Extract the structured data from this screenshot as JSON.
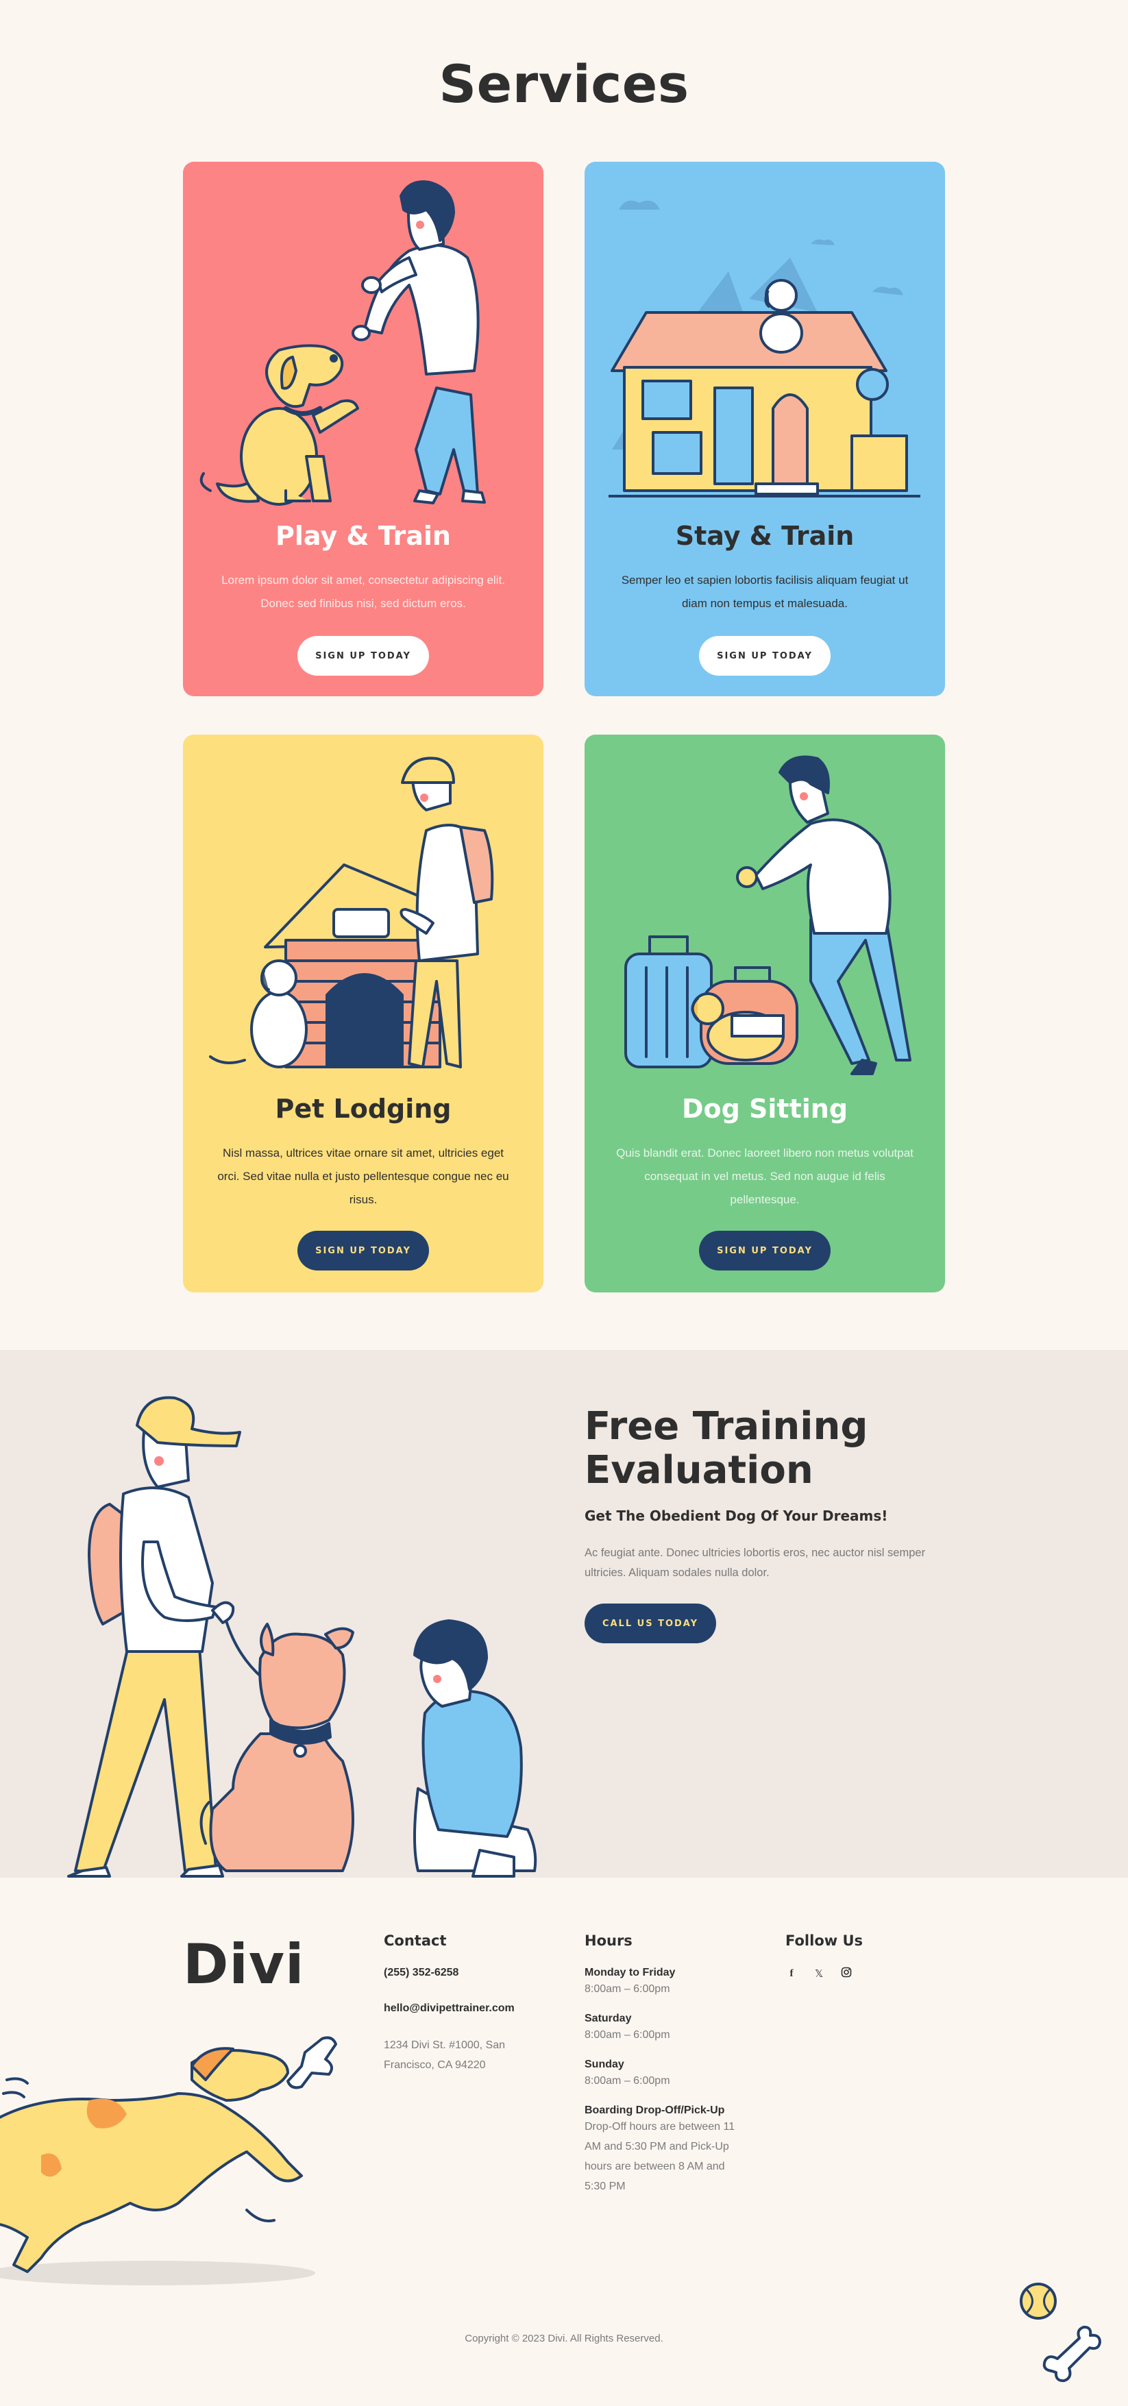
{
  "services": {
    "title": "Services",
    "cards": [
      {
        "title": "Play & Train",
        "description": "Lorem ipsum dolor sit amet, consectetur adipiscing elit. Donec sed finibus nisi, sed dictum eros.",
        "button": "SIGN UP TODAY",
        "bg_color": "#fd8484"
      },
      {
        "title": "Stay & Train",
        "description": "Semper leo et sapien lobortis facilisis aliquam feugiat ut diam non tempus et malesuada.",
        "button": "SIGN UP TODAY",
        "bg_color": "#7cc7f1"
      },
      {
        "title": "Pet Lodging",
        "description": "Nisl massa, ultrices vitae ornare sit amet, ultricies eget orci. Sed vitae nulla et justo pellentesque congue nec eu risus.",
        "button": "SIGN UP TODAY",
        "bg_color": "#fddf7d"
      },
      {
        "title": "Dog Sitting",
        "description": "Quis blandit erat. Donec laoreet libero non metus volutpat consequat in vel metus. Sed non augue id felis pellentesque.",
        "button": "SIGN UP TODAY",
        "bg_color": "#76cb88"
      }
    ]
  },
  "evaluation": {
    "title": "Free Training Evaluation",
    "subtitle": "Get The Obedient Dog Of Your Dreams!",
    "description": "Ac feugiat ante. Donec ultricies lobortis eros, nec auctor nisl semper ultricies. Aliquam sodales nulla dolor.",
    "button": "CALL US TODAY"
  },
  "footer": {
    "logo": "Divi",
    "contact": {
      "heading": "Contact",
      "phone": "(255) 352-6258",
      "email": "hello@divipettrainer.com",
      "address": "1234 Divi St. #1000, San Francisco, CA 94220"
    },
    "hours": {
      "heading": "Hours",
      "entries": [
        {
          "label": "Monday to Friday",
          "value": "8:00am – 6:00pm"
        },
        {
          "label": "Saturday",
          "value": "8:00am – 6:00pm"
        },
        {
          "label": "Sunday",
          "value": "8:00am – 6:00pm"
        },
        {
          "label": "Boarding Drop-Off/Pick-Up",
          "value": "Drop-Off hours are between 11 AM and 5:30 PM and Pick-Up hours are between 8 AM and 5:30 PM"
        }
      ]
    },
    "follow": {
      "heading": "Follow Us",
      "icons": [
        "facebook-icon",
        "x-twitter-icon",
        "instagram-icon"
      ]
    },
    "copyright": "Copyright © 2023 Divi. All Rights Reserved."
  },
  "colors": {
    "page_bg": "#fcf6f1",
    "eval_bg": "#efe8e3",
    "navy": "#23406a",
    "dark_text": "#2f2f2f",
    "yellow": "#fddf7d",
    "coral": "#fd8484",
    "sky": "#7cc7f1",
    "green": "#76cb88"
  }
}
